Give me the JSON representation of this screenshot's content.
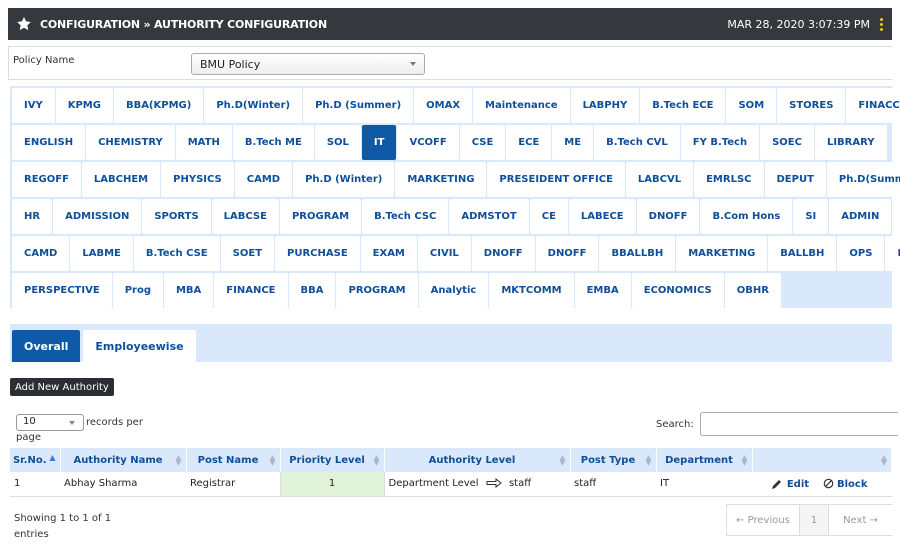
{
  "header": {
    "breadcrumb": "CONFIGURATION » AUTHORITY CONFIGURATION",
    "datetime": "MAR 28, 2020  3:07:39 PM",
    "star_icon": "star-icon",
    "menu_icon": "kebab-menu-icon"
  },
  "policy": {
    "label": "Policy Name",
    "value": "BMU Policy"
  },
  "departments": {
    "active": "IT",
    "rows": [
      [
        "IVY",
        "KPMG",
        "BBA(KPMG)",
        "Ph.D(Winter)",
        "Ph.D (Summer)",
        "OMAX",
        "Maintenance",
        "LABPHY",
        "B.Tech ECE",
        "SOM",
        "STORES",
        "FINACC"
      ],
      [
        "ENGLISH",
        "CHEMISTRY",
        "MATH",
        "B.Tech ME",
        "SOL",
        "IT",
        "VCOFF",
        "CSE",
        "ECE",
        "ME",
        "B.Tech CVL",
        "FY B.Tech",
        "SOEC",
        "LIBRARY"
      ],
      [
        "REGOFF",
        "LABCHEM",
        "PHYSICS",
        "CAMD",
        "Ph.D (Winter)",
        "MARKETING",
        "PRESEIDENT OFFICE",
        "LABCVL",
        "EMRLSC",
        "DEPUT",
        "Ph.D(Summer)"
      ],
      [
        "HR",
        "ADMISSION",
        "SPORTS",
        "LABCSE",
        "PROGRAM",
        "B.Tech CSC",
        "ADMSTOT",
        "CE",
        "LABECE",
        "DNOFF",
        "B.Com Hons",
        "SI",
        "ADMIN"
      ],
      [
        "CAMD",
        "LABME",
        "B.Tech CSE",
        "SOET",
        "PURCHASE",
        "EXAM",
        "CIVIL",
        "DNOFF",
        "DNOFF",
        "BBALLBH",
        "MARKETING",
        "BALLBH",
        "OPS",
        "DOL"
      ],
      [
        "PERSPECTIVE",
        "Prog",
        "MBA",
        "FINANCE",
        "BBA",
        "PROGRAM",
        "Analytic",
        "MKTCOMM",
        "EMBA",
        "ECONOMICS",
        "OBHR"
      ]
    ]
  },
  "tabs": {
    "overall": "Overall",
    "employeewise": "Employeewise",
    "active": "Overall"
  },
  "add_button": "Add New Authority",
  "length": {
    "value": "10",
    "suffix": "records per",
    "suffix2": "page"
  },
  "search": {
    "label": "Search:",
    "value": ""
  },
  "table": {
    "columns": [
      "Sr.No.",
      "Authority Name",
      "Post Name",
      "Priority Level",
      "Authority Level",
      "Post Type",
      "Department",
      ""
    ],
    "rows": [
      {
        "sr": "1",
        "name": "Abhay Sharma",
        "post": "Registrar",
        "priority": "1",
        "level_from": "Department Level",
        "level_to": "staff",
        "post_type": "staff",
        "department": "IT",
        "edit": "Edit",
        "block": "Block"
      }
    ]
  },
  "info": {
    "line1": "Showing 1 to 1 of 1",
    "line2": "entries"
  },
  "pager": {
    "prev": "← Previous",
    "page": "1",
    "next": "Next →"
  }
}
